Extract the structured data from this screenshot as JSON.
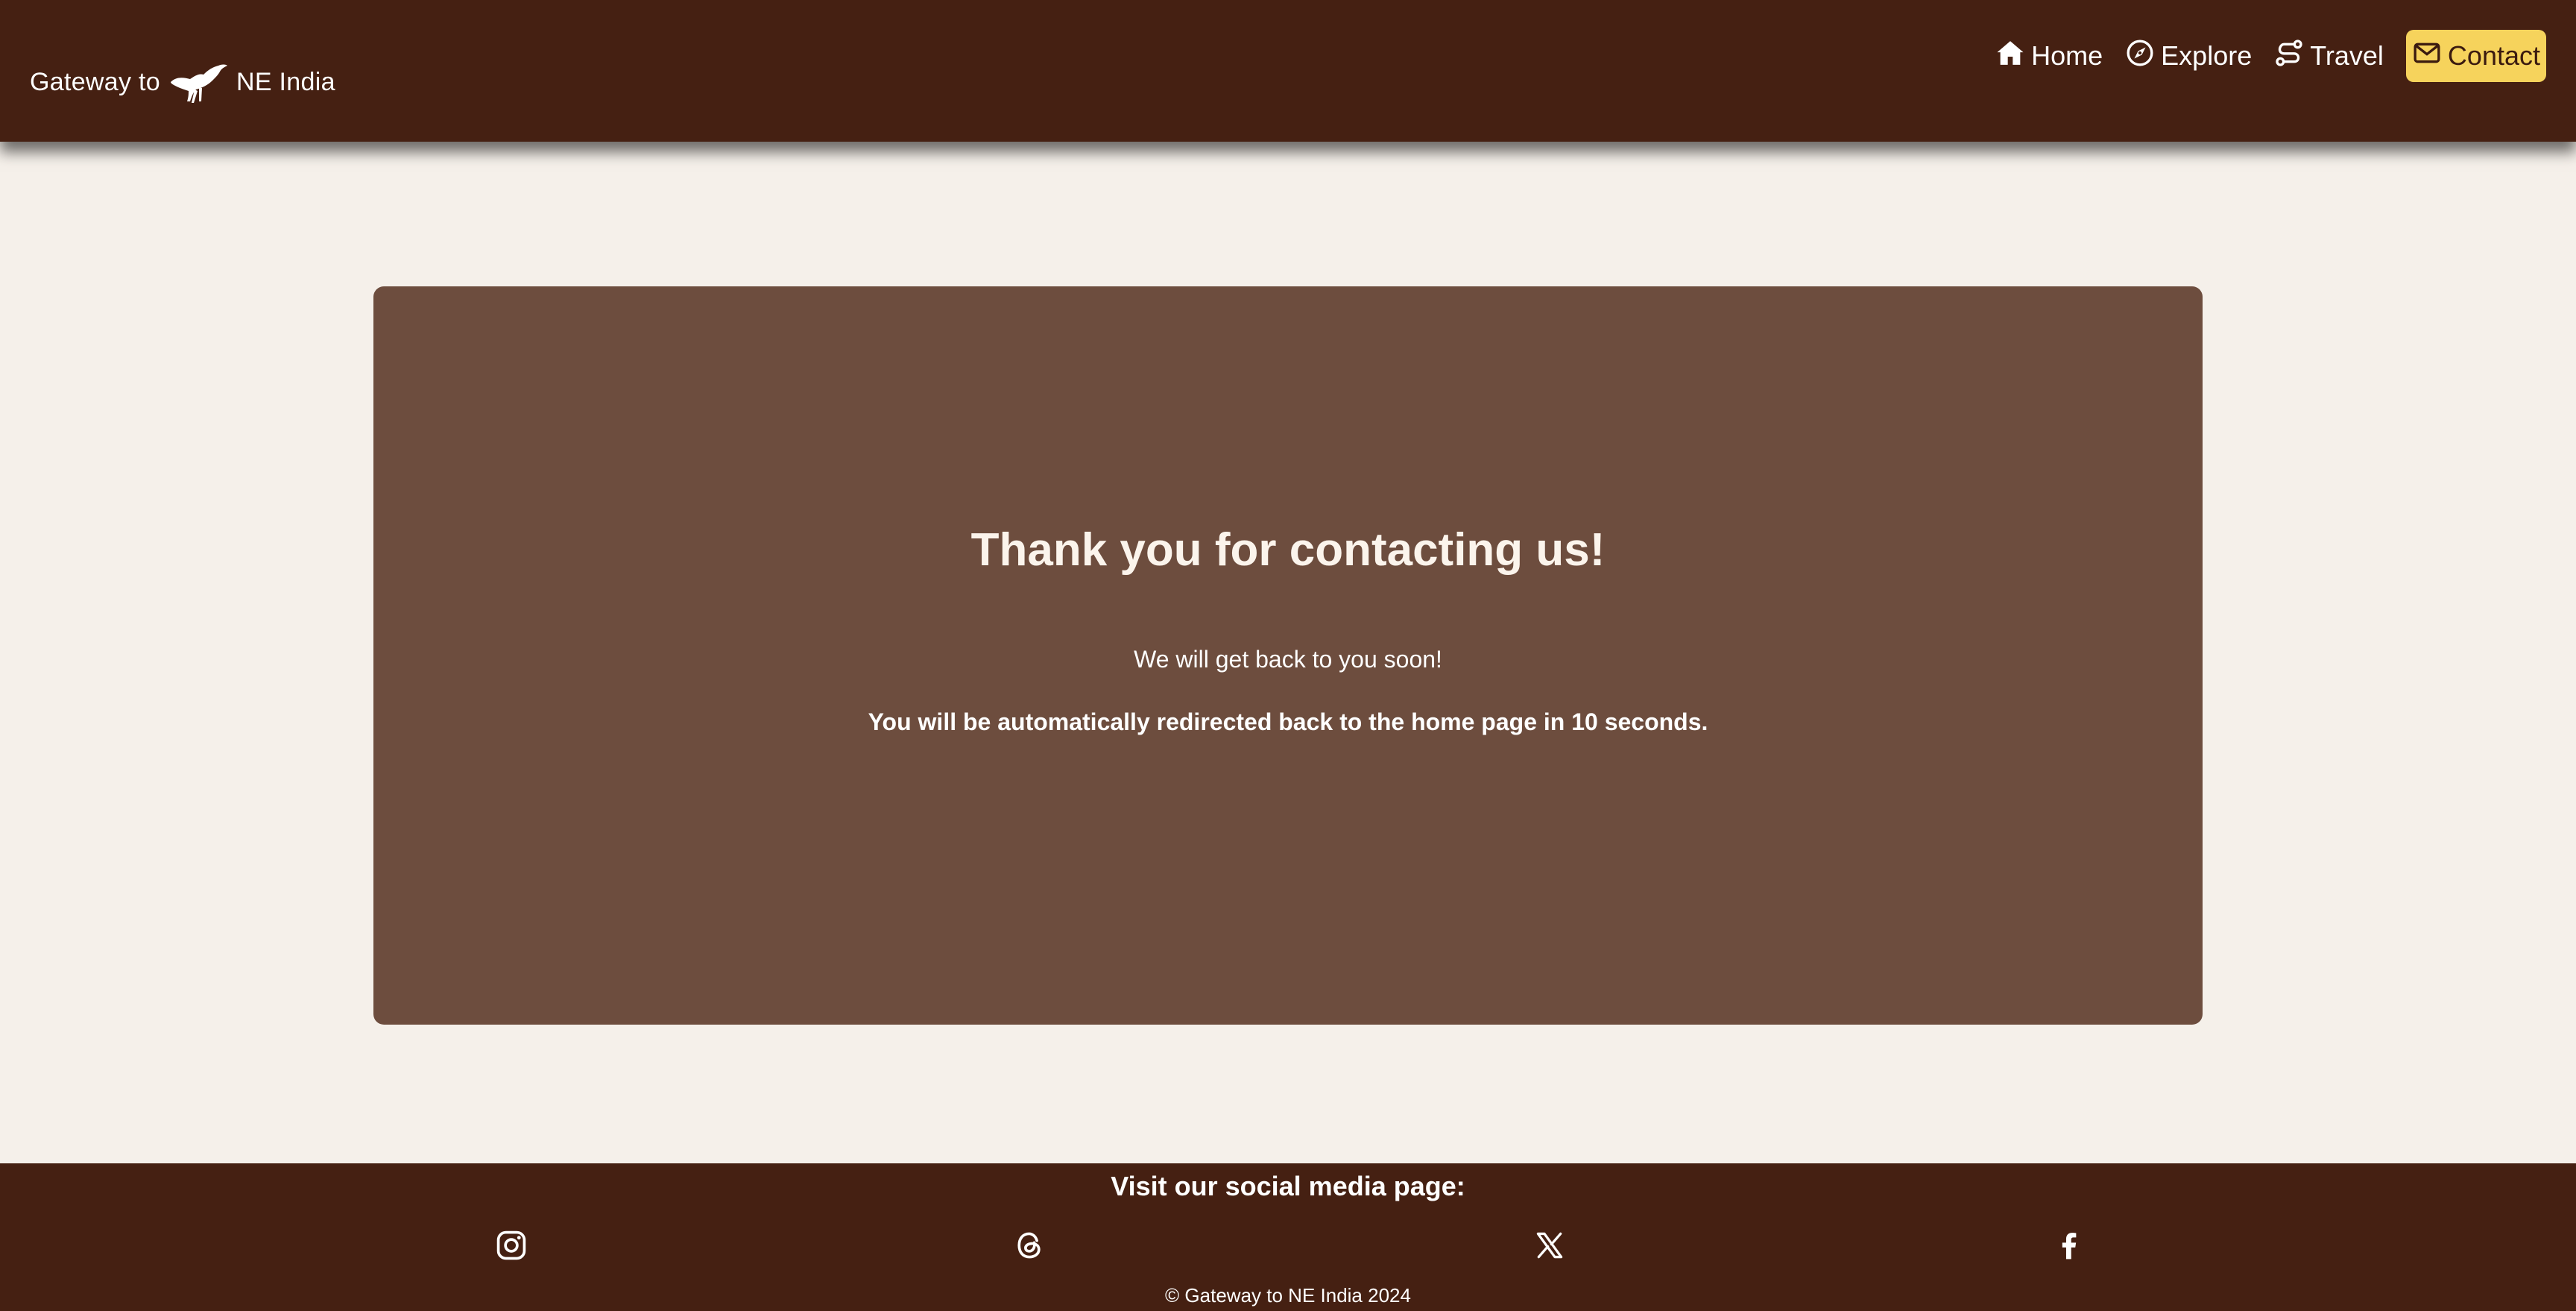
{
  "header": {
    "brand_prefix": "Gateway to",
    "brand_suffix": "NE India",
    "logo_icon": "hornbill-bird-icon",
    "nav": [
      {
        "label": "Home",
        "icon": "home-icon"
      },
      {
        "label": "Explore",
        "icon": "compass-icon"
      },
      {
        "label": "Travel",
        "icon": "route-icon"
      },
      {
        "label": "Contact",
        "icon": "envelope-icon"
      }
    ]
  },
  "main": {
    "title": "Thank you for contacting us!",
    "message": "We will get back to you soon!",
    "redirect": "You will be automatically redirected back to the home page in 10 seconds."
  },
  "footer": {
    "social_title": "Visit our social media page:",
    "icons": [
      "instagram-icon",
      "threads-icon",
      "x-icon",
      "facebook-icon"
    ],
    "copyright": "© Gateway to NE India 2024"
  },
  "colors": {
    "header_bg": "#452012",
    "page_bg": "#f5f0ea",
    "card_bg": "#6d4d3e",
    "accent": "#f6d35c"
  }
}
